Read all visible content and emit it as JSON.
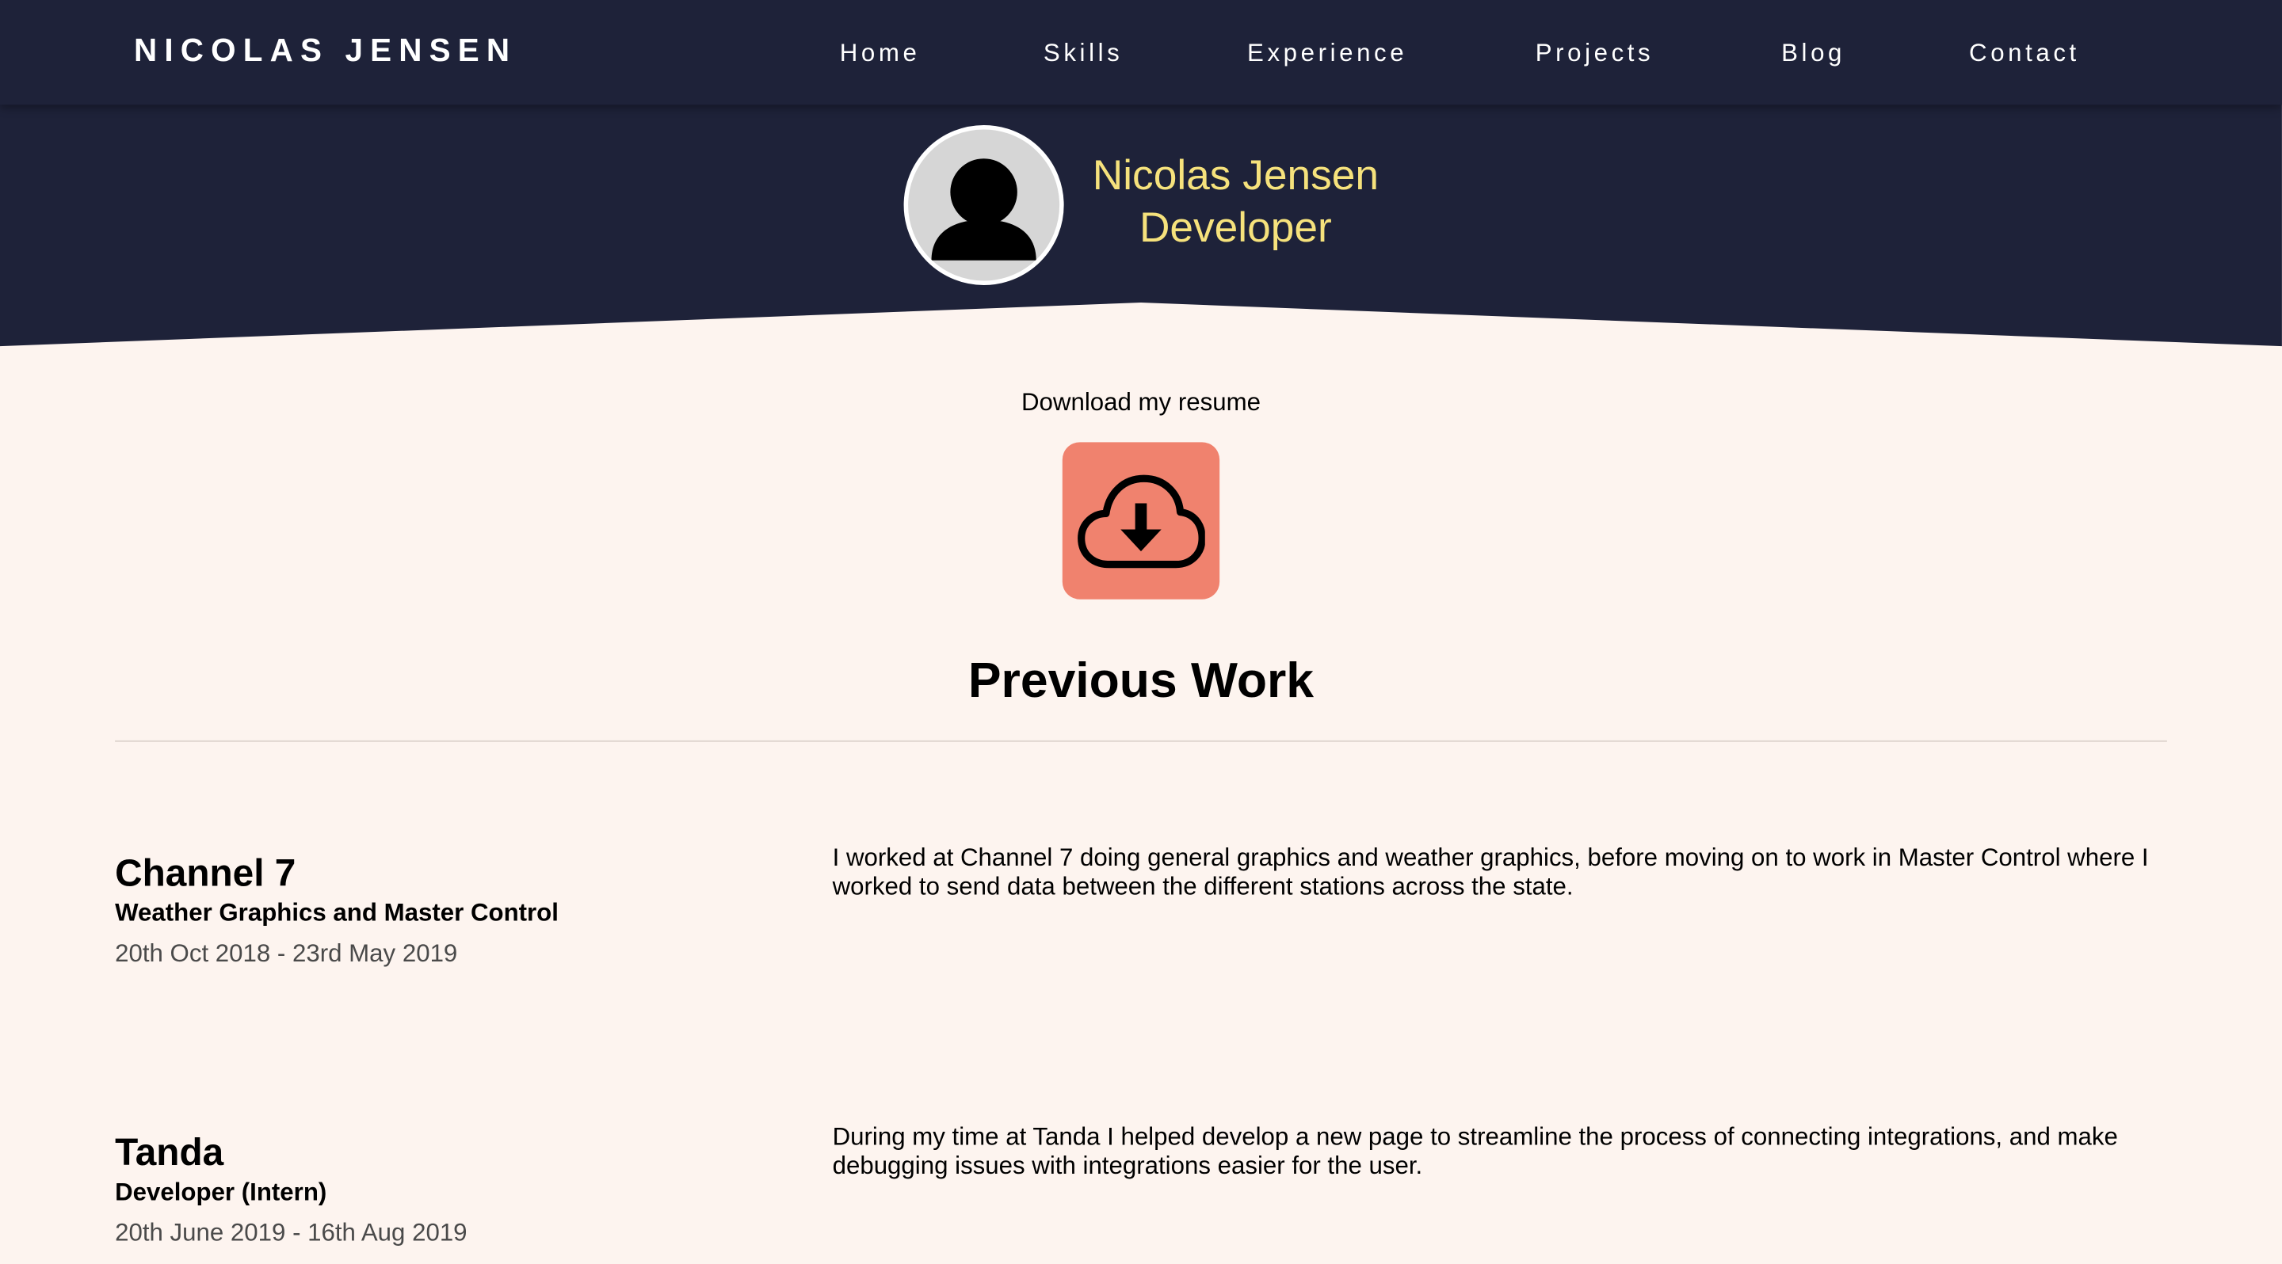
{
  "header": {
    "brand": "NICOLAS JENSEN",
    "nav": [
      "Home",
      "Skills",
      "Experience",
      "Projects",
      "Blog",
      "Contact"
    ],
    "colors": {
      "background": "#1e2239",
      "accent": "#f6e27c",
      "page": "#fdf4ef",
      "button": "#f0826e"
    }
  },
  "hero": {
    "avatar_icon": "user-silhouette-icon",
    "name": "Nicolas Jensen",
    "role": "Developer"
  },
  "resume": {
    "label": "Download my resume",
    "icon": "cloud-download-icon"
  },
  "work": {
    "title": "Previous Work",
    "jobs": [
      {
        "company": "Channel 7",
        "title": "Weather Graphics and Master Control",
        "dates": "20th Oct 2018 - 23rd May 2019",
        "description": "I worked at Channel 7 doing general graphics and weather graphics, before moving on to work in Master Control where I worked to send data between the different stations across the state."
      },
      {
        "company": "Tanda",
        "title": "Developer (Intern)",
        "dates": "20th June 2019 - 16th Aug 2019",
        "description": "During my time at Tanda I helped develop a new page to streamline the process of connecting integrations, and make debugging issues with integrations easier for the user."
      }
    ]
  }
}
